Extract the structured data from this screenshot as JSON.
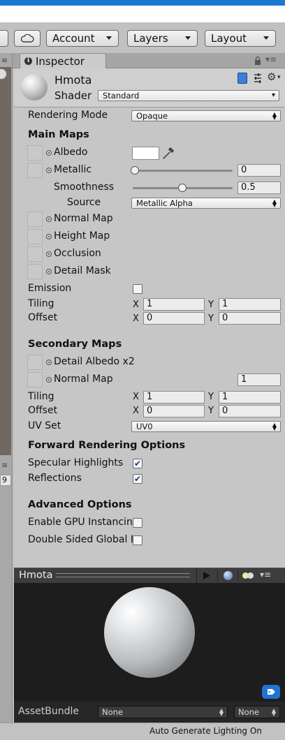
{
  "toolbar": {
    "cloud_icon": "cloud-icon",
    "account_label": "Account",
    "layers_label": "Layers",
    "layout_label": "Layout"
  },
  "left_panel": {
    "partial_value": "9"
  },
  "inspector": {
    "tab_label": "Inspector",
    "material_name": "Hmota",
    "shader_label": "Shader",
    "shader_value": "Standard",
    "rendering_mode_label": "Rendering Mode",
    "rendering_mode_value": "Opaque",
    "main_maps_title": "Main Maps",
    "albedo_label": "Albedo",
    "metallic_label": "Metallic",
    "metallic_value": "0",
    "smoothness_label": "Smoothness",
    "smoothness_value": "0.5",
    "source_label": "Source",
    "source_value": "Metallic Alpha",
    "normal_map_label": "Normal Map",
    "height_map_label": "Height Map",
    "occlusion_label": "Occlusion",
    "detail_mask_label": "Detail Mask",
    "emission_label": "Emission",
    "tiling_label": "Tiling",
    "offset_label": "Offset",
    "x_label": "X",
    "y_label": "Y",
    "main_tiling_x": "1",
    "main_tiling_y": "1",
    "main_offset_x": "0",
    "main_offset_y": "0",
    "secondary_maps_title": "Secondary Maps",
    "detail_albedo_label": "Detail Albedo x2",
    "sec_normal_map_label": "Normal Map",
    "sec_normal_value": "1",
    "sec_tiling_x": "1",
    "sec_tiling_y": "1",
    "sec_offset_x": "0",
    "sec_offset_y": "0",
    "uv_set_label": "UV Set",
    "uv_set_value": "UV0",
    "forward_title": "Forward Rendering Options",
    "specular_label": "Specular Highlights",
    "reflections_label": "Reflections",
    "check_mark": "✔",
    "advanced_title": "Advanced Options",
    "gpu_label": "Enable GPU Instancin",
    "double_sided_label": "Double Sided Global I"
  },
  "preview": {
    "title": "Hmota",
    "asset_bundle_label": "AssetBundle",
    "bundle_value": "None",
    "variant_value": "None"
  },
  "status": {
    "text": "Auto Generate Lighting On"
  },
  "colors": {
    "accent": "#1c79d2",
    "albedo_swatch": "#ffffff",
    "preview_bg": "#1d1d1d"
  }
}
